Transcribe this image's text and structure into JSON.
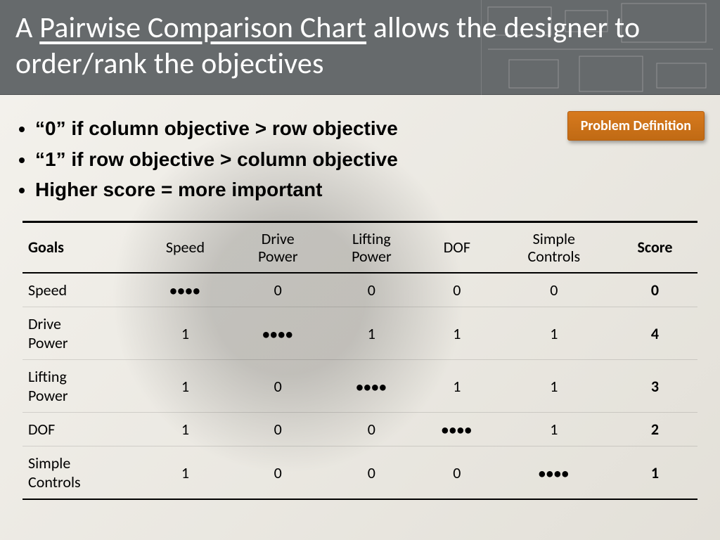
{
  "title": {
    "pre": "A ",
    "underlined": "Pairwise Comparison Chart",
    "post": " allows the designer to order/rank the objectives"
  },
  "badge": "Problem Definition",
  "rules": [
    "“0” if column objective > row objective",
    "“1” if row objective > column objective",
    "Higher score = more important"
  ],
  "diag": "••••",
  "chart_data": {
    "type": "table",
    "title": "Pairwise Comparison Chart",
    "columns": [
      "Goals",
      "Speed",
      "Drive Power",
      "Lifting Power",
      "DOF",
      "Simple Controls",
      "Score"
    ],
    "rows": [
      {
        "label": "Speed",
        "cells": [
          "diag",
          0,
          0,
          0,
          0
        ],
        "score": 0
      },
      {
        "label": "Drive Power",
        "cells": [
          1,
          "diag",
          1,
          1,
          1
        ],
        "score": 4
      },
      {
        "label": "Lifting Power",
        "cells": [
          1,
          0,
          "diag",
          1,
          1
        ],
        "score": 3
      },
      {
        "label": "DOF",
        "cells": [
          1,
          0,
          0,
          "diag",
          1
        ],
        "score": 2
      },
      {
        "label": "Simple Controls",
        "cells": [
          1,
          0,
          0,
          0,
          "diag"
        ],
        "score": 1
      }
    ]
  }
}
